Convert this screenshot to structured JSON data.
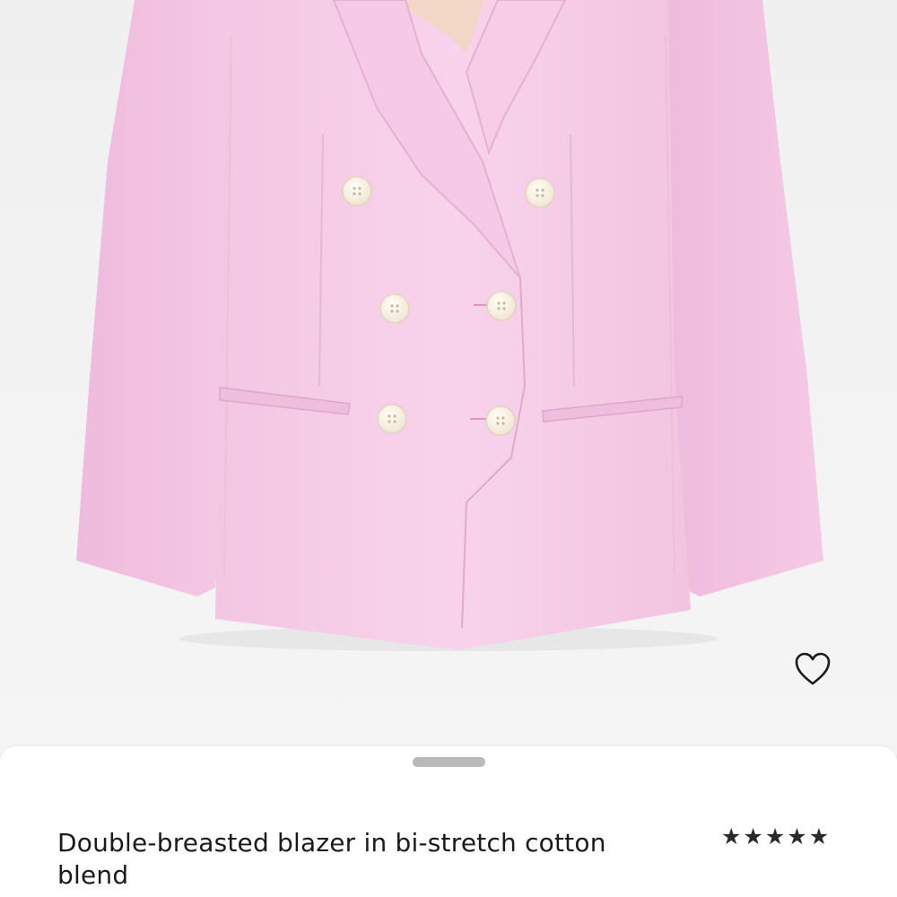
{
  "product": {
    "name": "Double-breasted blazer in bi-stretch cotton blend",
    "image": {
      "subject": "blazer",
      "fabric_color": "#f6cde8",
      "button_color": "#fbf5ea"
    },
    "rating": {
      "value": 5,
      "max": 5,
      "star_glyph": "★"
    }
  },
  "icons": {
    "wishlist": "heart-outline-icon",
    "sheet_handle": "drag-handle"
  }
}
